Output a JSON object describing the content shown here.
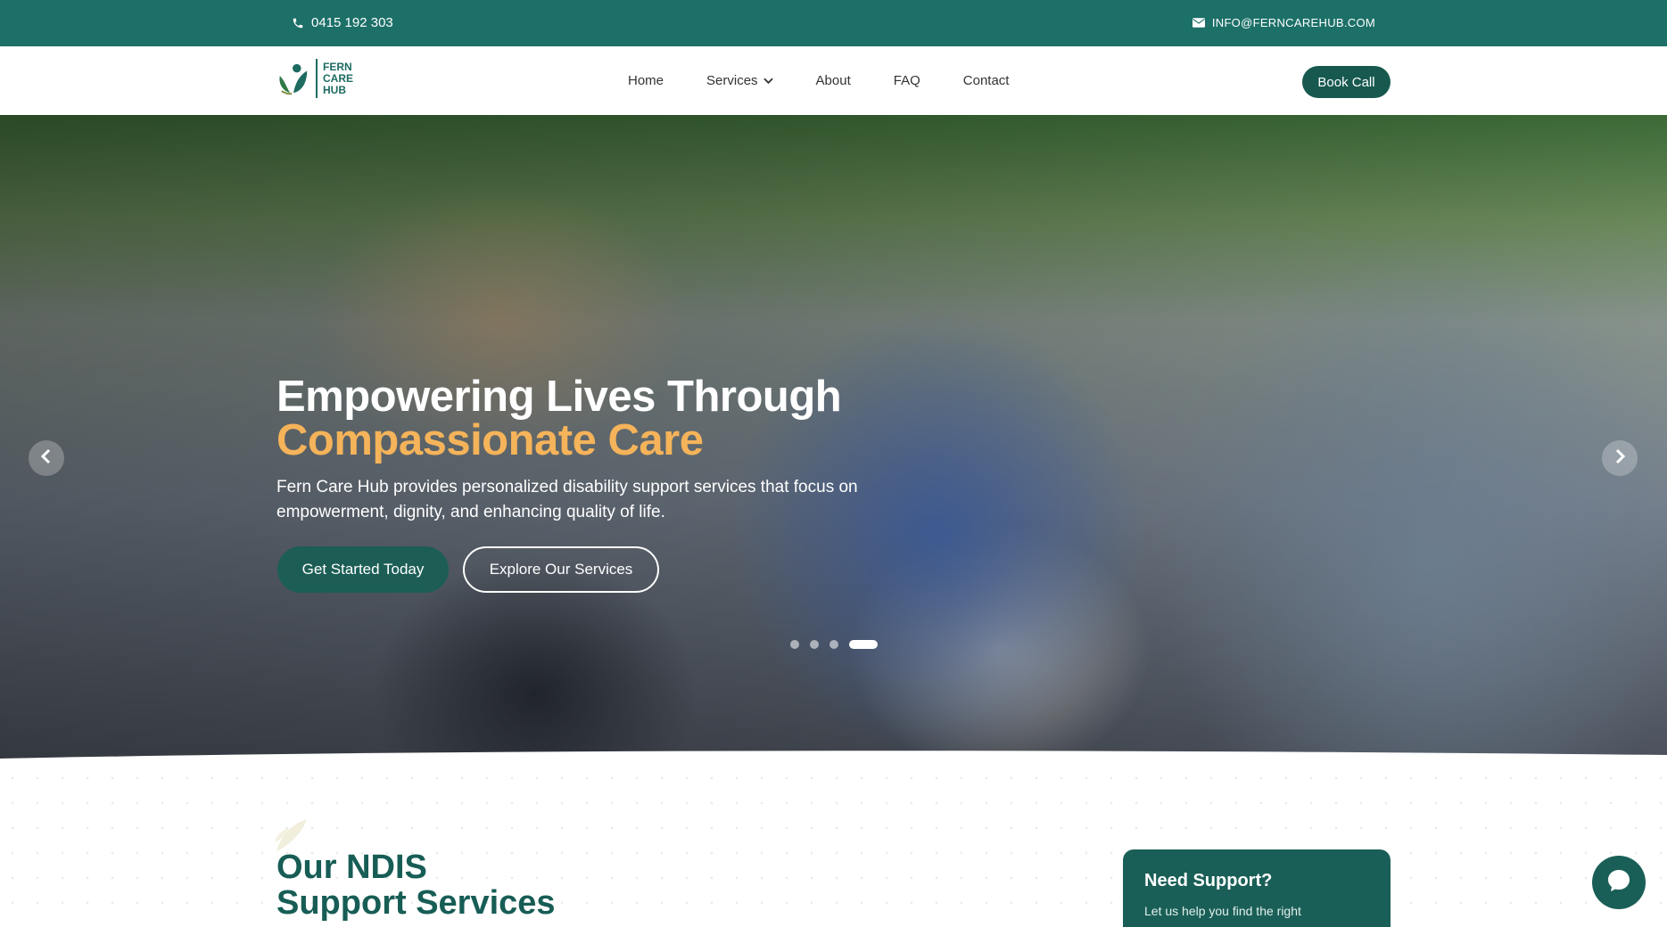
{
  "topbar": {
    "phone": "0415 192 303",
    "email": "INFO@FERNCAREHUB.COM"
  },
  "logo": {
    "line1": "FERN",
    "line2": "CARE",
    "line3": "HUB"
  },
  "nav": {
    "items": [
      {
        "label": "Home"
      },
      {
        "label": "Services"
      },
      {
        "label": "About"
      },
      {
        "label": "FAQ"
      },
      {
        "label": "Contact"
      }
    ],
    "cta": "Book Call"
  },
  "hero": {
    "title_line1": "Empowering Lives Through",
    "title_line2": "Compassionate Care",
    "description": "Fern Care Hub provides personalized disability support services that focus on empowerment, dignity, and enhancing quality of life.",
    "primary_button": "Get Started Today",
    "secondary_button": "Explore Our Services",
    "slide_count": 4,
    "active_slide": 4
  },
  "services": {
    "title_line1": "Our NDIS",
    "title_line2": "Support Services"
  },
  "support_card": {
    "title": "Need Support?",
    "subtitle": "Let us help you find the right"
  },
  "colors": {
    "brand_teal": "#1d7068",
    "brand_dark": "#17594f",
    "accent_orange": "#f5b35a"
  },
  "icons": {
    "phone": "phone-icon",
    "email": "envelope-icon",
    "dropdown": "chevron-down-icon",
    "prev": "chevron-left-icon",
    "next": "chevron-right-icon",
    "chat": "chat-bubble-icon"
  }
}
